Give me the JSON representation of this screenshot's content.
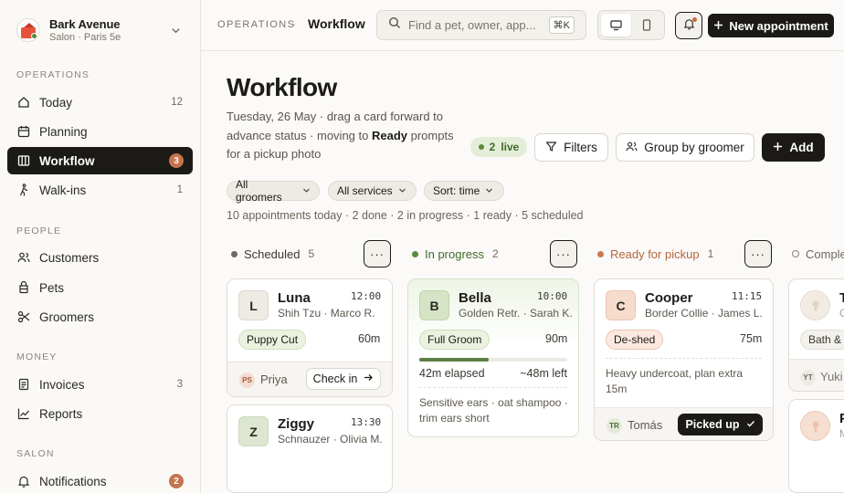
{
  "org": {
    "name": "Bark Avenue",
    "subtitle": "Salon · Paris 5e"
  },
  "nav": {
    "sections": {
      "operations": "OPERATIONS",
      "people": "PEOPLE",
      "money": "MONEY",
      "salon": "SALON"
    },
    "items": [
      {
        "label": "Today",
        "count": "12"
      },
      {
        "label": "Planning",
        "count": ""
      },
      {
        "label": "Workflow",
        "count": "3"
      },
      {
        "label": "Walk-ins",
        "count": "1"
      },
      {
        "label": "Customers",
        "count": ""
      },
      {
        "label": "Pets",
        "count": ""
      },
      {
        "label": "Groomers",
        "count": ""
      },
      {
        "label": "Invoices",
        "count": "3"
      },
      {
        "label": "Reports",
        "count": ""
      },
      {
        "label": "Notifications",
        "count": "2"
      }
    ]
  },
  "topbar": {
    "breadcrumb_root": "OPERATIONS",
    "breadcrumb_sep": "·",
    "breadcrumb_current": "Workflow",
    "search_placeholder": "Find a pet, owner, app...",
    "search_shortcut": "⌘K",
    "new_button": "New appointment"
  },
  "page": {
    "title": "Workflow",
    "desc_pre": "Tuesday, 26 May · drag a card forward to advance status · moving to ",
    "desc_bold": "Ready",
    "desc_post": " prompts for a pickup photo",
    "live_count": "2",
    "live_label": "live",
    "filters": "Filters",
    "group": "Group by groomer",
    "add": "Add",
    "chips": [
      "All groomers",
      "All services",
      "Sort: time"
    ],
    "summary": "10 appointments today · 2 done · 2 in progress · 1 ready · 5 scheduled"
  },
  "columns": [
    {
      "title": "Scheduled",
      "count": "5",
      "color": "#6f6a61"
    },
    {
      "title": "In progress",
      "count": "2",
      "color": "#5a8a3e"
    },
    {
      "title": "Ready for pickup",
      "count": "1",
      "color": "#c97a4e"
    },
    {
      "title": "Comple",
      "count": "",
      "color": "#8a857c"
    }
  ],
  "cards": {
    "luna": {
      "initial": "L",
      "name": "Luna",
      "sub": "Shih Tzu · Marco R.",
      "time": "12:00",
      "service": "Puppy Cut",
      "duration": "60m",
      "groomer_initials": "PS",
      "groomer": "Priya",
      "action": "Check in"
    },
    "ziggy": {
      "initial": "Z",
      "name": "Ziggy",
      "sub": "Schnauzer · Olivia M.",
      "time": "13:30"
    },
    "bella": {
      "initial": "B",
      "name": "Bella",
      "sub": "Golden Retr. · Sarah K.",
      "time": "10:00",
      "service": "Full Groom",
      "duration": "90m",
      "progress": 0.47,
      "elapsed": "42m elapsed",
      "left": "~48m left",
      "note": "Sensitive ears · oat shampoo · trim ears short"
    },
    "cooper": {
      "initial": "C",
      "name": "Cooper",
      "sub": "Border Collie · James L.",
      "time": "11:15",
      "service": "De-shed",
      "duration": "75m",
      "note": "Heavy undercoat, plan extra 15m",
      "groomer_initials": "TR",
      "groomer": "Tomás",
      "action": "Picked up"
    },
    "completed1": {
      "initial": "T",
      "sub": "C",
      "service": "Bath &",
      "groomer_initials": "YT",
      "groomer": "Yuki"
    },
    "completed2": {
      "initial": "P",
      "sub": "M"
    }
  },
  "colors": {
    "accent": "#1c1a17",
    "badge": "#c5744f",
    "live_bg": "#e4edd7",
    "progress": "#5e7e44"
  }
}
